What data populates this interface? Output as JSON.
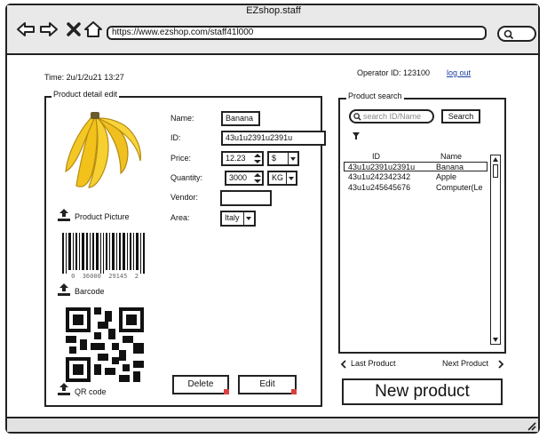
{
  "window": {
    "title": "EZshop.staff"
  },
  "browser": {
    "url": "https://www.ezshop.com/staff41l000"
  },
  "header": {
    "time": "Time: 2u/1/2u21 13:27",
    "operator": "Operator ID: 123100",
    "logout": "log out"
  },
  "detail": {
    "legend": "Product detail edit",
    "product_picture_label": "Product Picture",
    "barcode_label": "Barcode",
    "barcode_number": "0  36000  29145  2",
    "qr_label": "QR code",
    "name_label": "Name:",
    "name_value": "Banana",
    "id_label": "ID:",
    "id_value": "43u1u2391u2391u",
    "price_label": "Price:",
    "price_value": "12.23",
    "currency_value": "$",
    "quantity_label": "Quantity:",
    "quantity_value": "3000",
    "unit_value": "KG",
    "vendor_label": "Vendor:",
    "vendor_value": "",
    "area_label": "Area:",
    "area_value": "Italy",
    "delete_label": "Delete",
    "edit_label": "Edit"
  },
  "search": {
    "legend": "Product search",
    "placeholder": "search ID/Name",
    "button_label": "Search",
    "col_id": "ID",
    "col_name": "Name",
    "rows": [
      {
        "id": "43u1u2391u2391u",
        "name": "Banana"
      },
      {
        "id": "43u1u242342342",
        "name": "Apple"
      },
      {
        "id": "43u1u245645676",
        "name": "Computer(Le"
      }
    ],
    "prev_label": "Last Product",
    "next_label": "Next Product",
    "new_label": "New product"
  },
  "icons": [
    "back-arrow-icon",
    "forward-arrow-icon",
    "close-icon",
    "home-icon",
    "search-icon",
    "upload-icon",
    "filter-icon",
    "resize-grip-icon"
  ]
}
